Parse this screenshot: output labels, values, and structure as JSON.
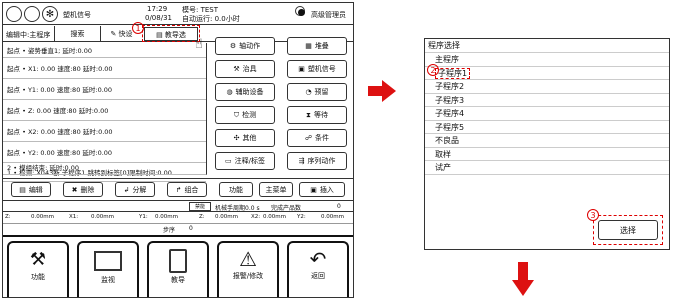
{
  "hmi": {
    "header": {
      "signal_label": "塑机信号",
      "time": "17:29",
      "date": "0/08/31",
      "mold_no_label": "模号: TEST",
      "auto_run_label": "自动运行: 0.0小时",
      "user_label": "高级管理员"
    },
    "toolbar": {
      "editing_label": "编辑中:主程序",
      "search_label": "搜索",
      "quick_label": "快设",
      "teach_label": "教导选"
    },
    "program_rows": [
      "起点 • 姿势垂直1; 延时:0.00",
      "起点 • X1: 0.00 速度:80  延时:0.00",
      "起点 • Y1: 0.00 速度:80  延时:0.00",
      "起点 • Z: 0.00 速度:80  延时:0.00",
      "起点 • X2: 0.00 速度:80  延时:0.00",
      "起点 • Y2: 0.00 速度:80  延时:0.00",
      "1 • 检测: X043断 子程序1 跳转到标签[0]限制时间:0.00",
      "2 • 模组结束: 延时:0.00"
    ],
    "side_buttons": {
      "axis_action": "轴动作",
      "stack": "堆叠",
      "fixture": "治具",
      "machine_signal": "塑机信号",
      "aux_device": "辅助设备",
      "reserve": "预留",
      "detect": "检测",
      "wait": "等待",
      "other": "其他",
      "condition": "条件",
      "comment_label": "注释/标签",
      "sequence_action": "序列动作"
    },
    "edit_buttons": {
      "edit": "编辑",
      "delete": "删除",
      "split": "分解",
      "combine": "组合",
      "function": "功能",
      "main_menu": "主菜单",
      "insert": "插入"
    },
    "status": {
      "small_btn": "禁能",
      "cycle_label": "机械手周期0.0 s",
      "completed_label": "完成产品数",
      "completed_value": "0"
    },
    "axes": [
      {
        "label": "Z:",
        "value": "0.00mm"
      },
      {
        "label": "X1:",
        "value": "0.00mm"
      },
      {
        "label": "Y1:",
        "value": "0.00mm"
      },
      {
        "label": "Z:",
        "value": "0.00mm"
      },
      {
        "label": "X2:",
        "value": "0.00mm"
      },
      {
        "label": "Y2:",
        "value": "0.00mm"
      }
    ],
    "step_label": "步序",
    "step_value": "0",
    "bottom_tabs": [
      "功能",
      "监视",
      "教导",
      "报警/修改",
      "返回"
    ]
  },
  "select_panel": {
    "title": "程序选择",
    "items": [
      "主程序",
      "子程序1",
      "子程序2",
      "子程序3",
      "子程序4",
      "子程序5",
      "不良品",
      "取样",
      "试产"
    ],
    "select_button": "选择"
  },
  "callouts": [
    "1",
    "2",
    "3"
  ],
  "colors": {
    "accent_red": "#dd1111"
  }
}
